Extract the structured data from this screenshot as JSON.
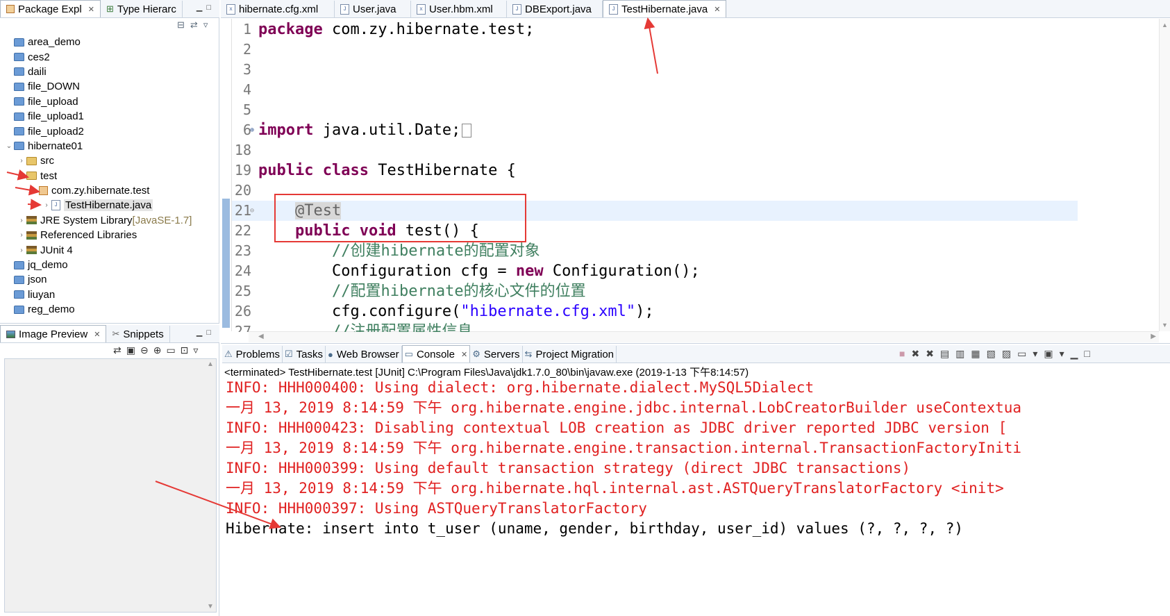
{
  "left_top_panel": {
    "tabs": [
      {
        "label": "Package Expl",
        "active": true
      },
      {
        "label": "Type Hierarc",
        "active": false
      }
    ],
    "tree": [
      {
        "label": "area_demo",
        "type": "project",
        "indent": 0
      },
      {
        "label": "ces2",
        "type": "project",
        "indent": 0
      },
      {
        "label": "daili",
        "type": "project",
        "indent": 0
      },
      {
        "label": "file_DOWN",
        "type": "project",
        "indent": 0
      },
      {
        "label": "file_upload",
        "type": "project",
        "indent": 0
      },
      {
        "label": "file_upload1",
        "type": "project",
        "indent": 0
      },
      {
        "label": "file_upload2",
        "type": "project",
        "indent": 0
      },
      {
        "label": "hibernate01",
        "type": "project-open",
        "indent": 0
      },
      {
        "label": "src",
        "type": "folder",
        "indent": 1
      },
      {
        "label": "test",
        "type": "folder",
        "indent": 1
      },
      {
        "label": "com.zy.hibernate.test",
        "type": "package",
        "indent": 2
      },
      {
        "label": "TestHibernate.java",
        "type": "java",
        "indent": 3
      },
      {
        "label": "JRE System Library",
        "suffix": "[JavaSE-1.7]",
        "type": "library",
        "indent": 1
      },
      {
        "label": "Referenced Libraries",
        "type": "library",
        "indent": 1
      },
      {
        "label": "JUnit 4",
        "type": "library",
        "indent": 1
      },
      {
        "label": "jq_demo",
        "type": "project",
        "indent": 0
      },
      {
        "label": "json",
        "type": "project",
        "indent": 0
      },
      {
        "label": "liuyan",
        "type": "project",
        "indent": 0
      },
      {
        "label": "reg_demo",
        "type": "project",
        "indent": 0
      }
    ]
  },
  "left_bottom_panel": {
    "tabs": [
      {
        "label": "Image Preview",
        "active": true
      },
      {
        "label": "Snippets",
        "active": false
      }
    ]
  },
  "editor": {
    "tabs": [
      {
        "label": "hibernate.cfg.xml",
        "active": false
      },
      {
        "label": "User.java",
        "active": false
      },
      {
        "label": "User.hbm.xml",
        "active": false
      },
      {
        "label": "DBExport.java",
        "active": false
      },
      {
        "label": "TestHibernate.java",
        "active": true
      }
    ],
    "lines": [
      {
        "n": "1",
        "parts": [
          [
            "kw",
            "package"
          ],
          [
            "",
            "com.zy.hibernate.test;"
          ]
        ]
      },
      {
        "n": "2",
        "parts": []
      },
      {
        "n": "3",
        "parts": []
      },
      {
        "n": "4",
        "parts": []
      },
      {
        "n": "5",
        "parts": []
      },
      {
        "n": "6",
        "parts": [
          [
            "kw",
            "import"
          ],
          [
            "",
            " java.util.Date;"
          ]
        ]
      },
      {
        "n": "18",
        "parts": []
      },
      {
        "n": "19",
        "parts": [
          [
            "kw",
            "public class"
          ],
          [
            "",
            " TestHibernate {"
          ]
        ]
      },
      {
        "n": "20",
        "parts": []
      },
      {
        "n": "21",
        "parts": [
          [
            "",
            "    "
          ],
          [
            "ann",
            "@Test"
          ]
        ]
      },
      {
        "n": "22",
        "parts": [
          [
            "",
            "    "
          ],
          [
            "kw",
            "public void"
          ],
          [
            "",
            " test() {"
          ]
        ]
      },
      {
        "n": "23",
        "parts": [
          [
            "",
            "        "
          ],
          [
            "cmt",
            "//创建hibernate的配置对象"
          ]
        ]
      },
      {
        "n": "24",
        "parts": [
          [
            "",
            "        Configuration cfg = "
          ],
          [
            "kw",
            "new"
          ],
          [
            "",
            " Configuration();"
          ]
        ]
      },
      {
        "n": "25",
        "parts": [
          [
            "",
            "        "
          ],
          [
            "cmt",
            "//配置hibernate的核心文件的位置"
          ]
        ]
      },
      {
        "n": "26",
        "parts": [
          [
            "",
            "        cfg.configure("
          ],
          [
            "str",
            "\"hibernate.cfg.xml\""
          ],
          [
            "",
            ");"
          ]
        ]
      },
      {
        "n": "27",
        "parts": [
          [
            "",
            "        "
          ],
          [
            "cmt",
            "//注册配置属性信息"
          ]
        ]
      }
    ]
  },
  "bottom_panel": {
    "tabs": [
      {
        "label": "Problems",
        "active": false
      },
      {
        "label": "Tasks",
        "active": false
      },
      {
        "label": "Web Browser",
        "active": false
      },
      {
        "label": "Console",
        "active": true
      },
      {
        "label": "Servers",
        "active": false
      },
      {
        "label": "Project Migration",
        "active": false
      }
    ],
    "status_line": "<terminated> TestHibernate.test [JUnit] C:\\Program Files\\Java\\jdk1.7.0_80\\bin\\javaw.exe (2019-1-13 下午8:14:57)",
    "console_lines": [
      {
        "text": "INFO: HHH000400: Using dialect: org.hibernate.dialect.MySQL5Dialect",
        "color": "red"
      },
      {
        "text": "一月 13, 2019 8:14:59 下午 org.hibernate.engine.jdbc.internal.LobCreatorBuilder useContextua",
        "color": "red"
      },
      {
        "text": "INFO: HHH000423: Disabling contextual LOB creation as JDBC driver reported JDBC version [",
        "color": "red"
      },
      {
        "text": "一月 13, 2019 8:14:59 下午 org.hibernate.engine.transaction.internal.TransactionFactoryIniti",
        "color": "red"
      },
      {
        "text": "INFO: HHH000399: Using default transaction strategy (direct JDBC transactions)",
        "color": "red"
      },
      {
        "text": "一月 13, 2019 8:14:59 下午 org.hibernate.hql.internal.ast.ASTQueryTranslatorFactory <init>",
        "color": "red"
      },
      {
        "text": "INFO: HHH000397: Using ASTQueryTranslatorFactory",
        "color": "red"
      },
      {
        "text": "Hibernate: insert into t_user (uname, gender, birthday, user_id) values (?, ?, ?, ?)",
        "color": "black"
      }
    ]
  },
  "colors": {
    "annotation_red": "#e53935",
    "console_red": "#e02020",
    "keyword": "#7f0055",
    "string": "#2a00ff",
    "comment": "#3f7f5f"
  }
}
